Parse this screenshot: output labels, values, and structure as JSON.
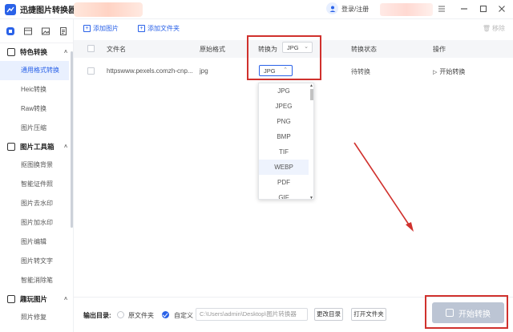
{
  "app": {
    "title": "迅捷图片转换器"
  },
  "header": {
    "login_label": "登录/注册",
    "accent": "#2a62e8"
  },
  "sidebar": {
    "sections": [
      {
        "label": "特色转换",
        "items": [
          "通用格式转换",
          "Heic转换",
          "Raw转换",
          "图片压缩"
        ]
      },
      {
        "label": "图片工具箱",
        "items": [
          "抠图换背景",
          "智能证件照",
          "图片去水印",
          "图片加水印",
          "图片编辑",
          "图片转文字",
          "智能消除笔"
        ]
      },
      {
        "label": "趣玩图片",
        "items": [
          "照片修复"
        ]
      }
    ],
    "active_item": "通用格式转换"
  },
  "toolbar": {
    "add_image": "添加图片",
    "add_folder": "添加文件夹",
    "delete": "移除"
  },
  "table": {
    "headers": {
      "filename": "文件名",
      "original_format": "原始格式",
      "convert_to": "转换为",
      "status": "转换状态",
      "action": "操作"
    },
    "header_select_value": "JPG",
    "rows": [
      {
        "filename": "httpswww.pexels.comzh-cnp...",
        "original_format": "jpg",
        "target_format": "JPG",
        "status": "待转换",
        "action": "开始转换"
      }
    ]
  },
  "dropdown": {
    "options": [
      "JPG",
      "JPEG",
      "PNG",
      "BMP",
      "TIF",
      "WEBP",
      "PDF",
      "GIF"
    ],
    "highlighted": "WEBP"
  },
  "output": {
    "label": "输出目录:",
    "option_original": "原文件夹",
    "option_custom": "自定义",
    "selected": "自定义",
    "path_placeholder": "C:\\Users\\admin\\Desktop\\图片转换器",
    "change_dir_button": "更改目录",
    "open_folder_button": "打开文件夹"
  },
  "start_button": {
    "label": "开始转换"
  },
  "colors": {
    "highlight_box": "#d0312d",
    "start_button_bg": "#bcc5d4"
  }
}
